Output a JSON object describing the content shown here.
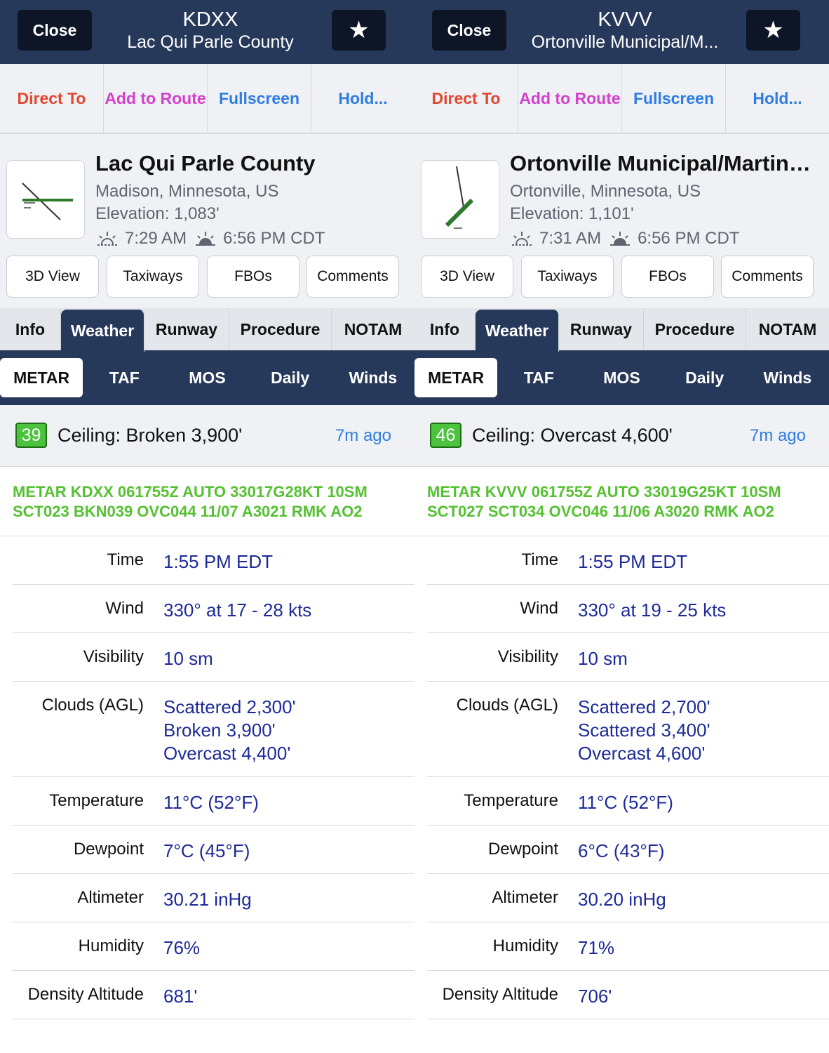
{
  "colors": {
    "header_bg": "#27395a",
    "direct_to": "#e2482f",
    "add_route": "#d43fcd",
    "fullscreen": "#2f7de1",
    "hold": "#2f7de1",
    "metar_text": "#55c132",
    "value_text": "#1d2a99"
  },
  "panels": [
    {
      "header": {
        "close": "Close",
        "ident": "KDXX",
        "name": "Lac Qui Parle County",
        "star": "★"
      },
      "actions": {
        "direct_to": "Direct To",
        "add_to_route": "Add to Route",
        "fullscreen": "Fullscreen",
        "hold": "Hold..."
      },
      "airport": {
        "name": "Lac Qui Parle County",
        "location": "Madison, Minnesota, US",
        "elevation": "Elevation: 1,083'",
        "sunrise": "7:29 AM",
        "sunset": "6:56 PM CDT"
      },
      "quick": {
        "view3d": "3D View",
        "taxiways": "Taxiways",
        "fbos": "FBOs",
        "comments": "Comments"
      },
      "tabs": [
        "Info",
        "Weather",
        "Runway",
        "Procedure",
        "NOTAM"
      ],
      "active_tab": "Weather",
      "subtabs": [
        "METAR",
        "TAF",
        "MOS",
        "Daily",
        "Winds"
      ],
      "ceiling": {
        "badge": "39",
        "text": "Ceiling: Broken 3,900'",
        "age": "7m ago"
      },
      "metar_raw": "METAR KDXX 061755Z AUTO 33017G28KT 10SM SCT023 BKN039 OVC044 11/07 A3021 RMK AO2",
      "rows": {
        "time": {
          "label": "Time",
          "value": "1:55 PM EDT"
        },
        "wind": {
          "label": "Wind",
          "value": "330° at 17 - 28 kts"
        },
        "visibility": {
          "label": "Visibility",
          "value": "10 sm"
        },
        "clouds": {
          "label": "Clouds (AGL)",
          "l1": "Scattered 2,300'",
          "l2": "Broken 3,900'",
          "l3": "Overcast 4,400'"
        },
        "temperature": {
          "label": "Temperature",
          "value": "11°C (52°F)"
        },
        "dewpoint": {
          "label": "Dewpoint",
          "value": "7°C (45°F)"
        },
        "altimeter": {
          "label": "Altimeter",
          "value": "30.21 inHg"
        },
        "humidity": {
          "label": "Humidity",
          "value": "76%"
        },
        "density": {
          "label": "Density Altitude",
          "value": "681'"
        }
      }
    },
    {
      "header": {
        "close": "Close",
        "ident": "KVVV",
        "name": "Ortonville Municipal/M...",
        "star": "★"
      },
      "actions": {
        "direct_to": "Direct To",
        "add_to_route": "Add to Route",
        "fullscreen": "Fullscreen",
        "hold": "Hold..."
      },
      "airport": {
        "name": "Ortonville Municipal/Martins...",
        "location": "Ortonville, Minnesota, US",
        "elevation": "Elevation: 1,101'",
        "sunrise": "7:31 AM",
        "sunset": "6:56 PM CDT"
      },
      "quick": {
        "view3d": "3D View",
        "taxiways": "Taxiways",
        "fbos": "FBOs",
        "comments": "Comments"
      },
      "tabs": [
        "Info",
        "Weather",
        "Runway",
        "Procedure",
        "NOTAM"
      ],
      "active_tab": "Weather",
      "subtabs": [
        "METAR",
        "TAF",
        "MOS",
        "Daily",
        "Winds"
      ],
      "ceiling": {
        "badge": "46",
        "text": "Ceiling: Overcast 4,600'",
        "age": "7m ago"
      },
      "metar_raw": "METAR KVVV 061755Z AUTO 33019G25KT 10SM SCT027 SCT034 OVC046 11/06 A3020 RMK AO2",
      "rows": {
        "time": {
          "label": "Time",
          "value": "1:55 PM EDT"
        },
        "wind": {
          "label": "Wind",
          "value": "330° at 19 - 25 kts"
        },
        "visibility": {
          "label": "Visibility",
          "value": "10 sm"
        },
        "clouds": {
          "label": "Clouds (AGL)",
          "l1": "Scattered 2,700'",
          "l2": "Scattered 3,400'",
          "l3": "Overcast 4,600'"
        },
        "temperature": {
          "label": "Temperature",
          "value": "11°C (52°F)"
        },
        "dewpoint": {
          "label": "Dewpoint",
          "value": "6°C (43°F)"
        },
        "altimeter": {
          "label": "Altimeter",
          "value": "30.20 inHg"
        },
        "humidity": {
          "label": "Humidity",
          "value": "71%"
        },
        "density": {
          "label": "Density Altitude",
          "value": "706'"
        }
      }
    }
  ]
}
